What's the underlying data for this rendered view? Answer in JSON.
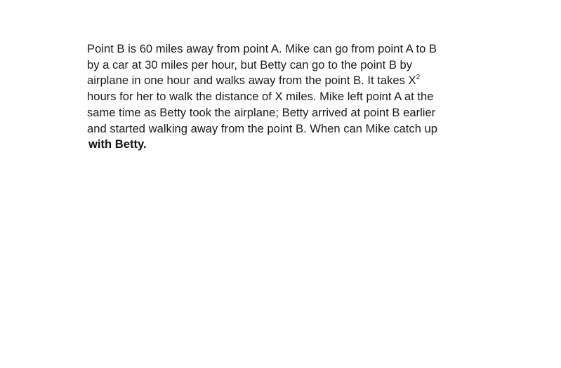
{
  "problem": {
    "line1": "Point B is 60 miles away from point A.  Mike can go from point A to B",
    "line2": "by a car at 30 miles per hour, but Betty can go to the point B by",
    "line3_pre": "airplane in one hour and walks away from the point B. It takes X",
    "line3_sup": "2",
    "line4": "hours for her to walk the distance of X miles.  Mike left point A at the",
    "line5": "same time as Betty took the airplane; Betty arrived at point B earlier",
    "line6": "and started walking away from the point B. When can Mike catch up",
    "line7": "with Betty."
  }
}
